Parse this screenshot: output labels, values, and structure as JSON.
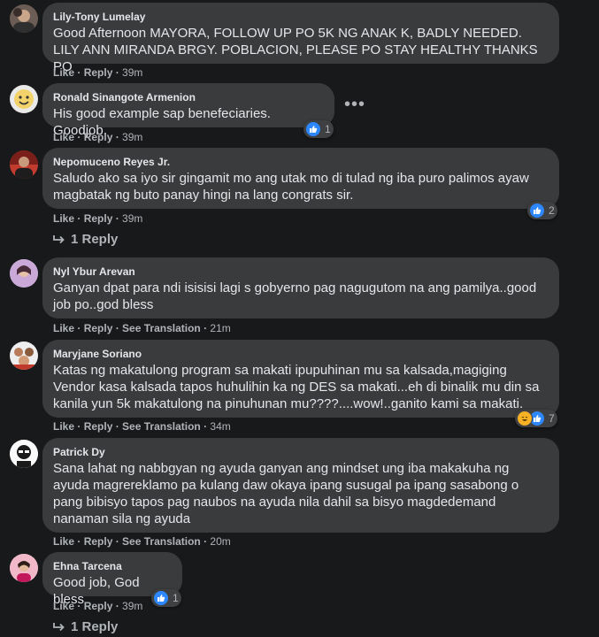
{
  "actions": {
    "like": "Like",
    "reply": "Reply",
    "see_translation": "See Translation",
    "sep": " · "
  },
  "more_options_icon": "more-horizontal-icon",
  "comments": [
    {
      "author": "Lily-Tony Lumelay",
      "text": "Good Afternoon MAYORA, FOLLOW UP PO 5K NG ANAK K, BADLY NEEDED. LILY ANN MIRANDA BRGY. POBLACION, PLEASE PO STAY HEALTHY THANKS PO",
      "time": "39m"
    },
    {
      "author": "Ronald Sinangote Armenion",
      "text": "His good example sap benefeciaries. Goodjob,",
      "time": "39m",
      "reactions": "1"
    },
    {
      "author": "Nepomuceno Reyes Jr.",
      "text": "Saludo ako sa iyo sir gingamit mo ang utak mo di tulad ng iba puro palimos ayaw magbatak ng buto panay hingi na lang congrats sir.",
      "time": "39m",
      "reactions": "2",
      "replies": "1 Reply"
    },
    {
      "author": "Nyl Ybur Arevan",
      "text": "Ganyan dpat para ndi isisisi lagi s gobyerno pag nagugutom na ang pamilya..good job po..god bless",
      "time": "21m"
    },
    {
      "author": "Maryjane Soriano",
      "text": "Katas ng makatulong program sa makati ipupuhinan mu sa kalsada,magiging Vendor kasa kalsada tapos huhulihin ka ng DES sa makati...eh di binalik mu din sa kanila yun 5k makatulong na pinuhunan mu????....wow!..ganito kami sa makati.",
      "time": "34m",
      "reactions": "7"
    },
    {
      "author": "Patrick Dy",
      "text": "Sana lahat ng nabbgyan ng ayuda ganyan ang mindset ung iba makakuha ng ayuda magrereklamo pa kulang daw okaya ipang susugal pa ipang sasabong o pang bibisyo tapos pag naubos na ayuda nila dahil sa bisyo magdedemand nanaman sila ng ayuda",
      "time": "20m"
    },
    {
      "author": "Ehna Tarcena",
      "text": "Good job, God bless",
      "time": "39m",
      "reactions": "1",
      "replies": "1 Reply"
    }
  ],
  "colors": {
    "background": "#18191a",
    "bubble": "#3a3b3c",
    "like_blue": "#2d88ff",
    "haha_yellow": "#f7b125"
  }
}
